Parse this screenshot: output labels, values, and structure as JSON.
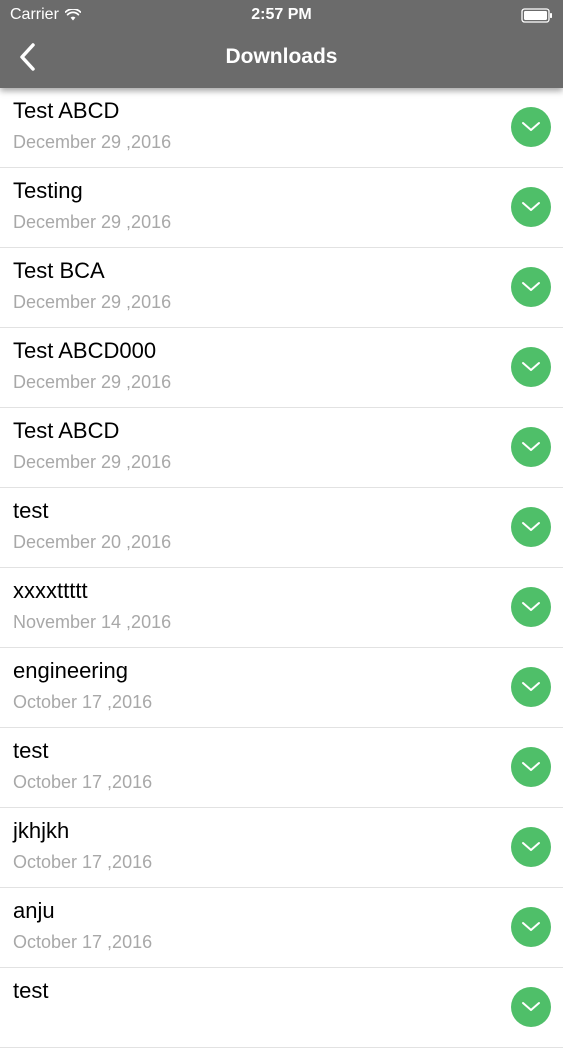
{
  "status_bar": {
    "carrier": "Carrier",
    "time": "2:57 PM",
    "wifi_icon": "wifi-icon",
    "battery_icon": "battery-icon"
  },
  "nav": {
    "title": "Downloads",
    "back_icon": "chevron-left-icon"
  },
  "colors": {
    "nav_background": "#6b6b6b",
    "accent_green": "#4fbf69",
    "date_gray": "#a8a8a8"
  },
  "items": [
    {
      "title": "Test ABCD",
      "date": "December 29 ,2016",
      "icon": "chevron-down-icon"
    },
    {
      "title": "Testing",
      "date": "December 29 ,2016",
      "icon": "chevron-down-icon"
    },
    {
      "title": "Test BCA",
      "date": "December 29 ,2016",
      "icon": "chevron-down-icon"
    },
    {
      "title": "Test ABCD000",
      "date": "December 29 ,2016",
      "icon": "chevron-down-icon"
    },
    {
      "title": "Test ABCD",
      "date": "December 29 ,2016",
      "icon": "chevron-down-icon"
    },
    {
      "title": "test",
      "date": "December 20 ,2016",
      "icon": "chevron-down-icon"
    },
    {
      "title": "xxxxttttt",
      "date": "November 14 ,2016",
      "icon": "chevron-down-icon"
    },
    {
      "title": "engineering",
      "date": "October 17 ,2016",
      "icon": "chevron-down-icon"
    },
    {
      "title": "test",
      "date": "October 17 ,2016",
      "icon": "chevron-down-icon"
    },
    {
      "title": "jkhjkh",
      "date": "October 17 ,2016",
      "icon": "chevron-down-icon"
    },
    {
      "title": "anju",
      "date": "October 17 ,2016",
      "icon": "chevron-down-icon"
    },
    {
      "title": "test",
      "date": "",
      "icon": "chevron-down-icon"
    }
  ]
}
